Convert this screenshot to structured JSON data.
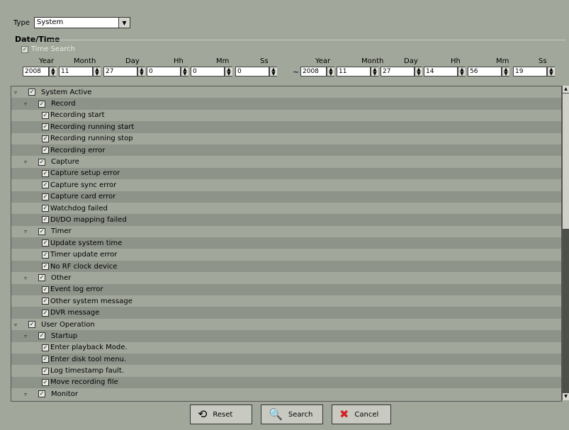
{
  "type_filter": {
    "label": "Type",
    "selected": "System"
  },
  "datetime": {
    "title": "Date/Time",
    "time_search_label": "Time Search",
    "labels": [
      "Year",
      "Month",
      "Day",
      "Hh",
      "Mm",
      "Ss"
    ],
    "from": [
      "2008",
      "11",
      "27",
      "0",
      "0",
      "0"
    ],
    "to": [
      "2008",
      "11",
      "27",
      "14",
      "56",
      "19"
    ],
    "separator": "~"
  },
  "tree": [
    {
      "level": 0,
      "expander": true,
      "label": "System Active"
    },
    {
      "level": 1,
      "expander": true,
      "label": "Record"
    },
    {
      "level": 2,
      "label": "Recording start"
    },
    {
      "level": 2,
      "label": "Recording running start"
    },
    {
      "level": 2,
      "label": "Recording running stop"
    },
    {
      "level": 2,
      "label": "Recording error"
    },
    {
      "level": 1,
      "expander": true,
      "label": "Capture"
    },
    {
      "level": 2,
      "label": "Capture setup error"
    },
    {
      "level": 2,
      "label": "Capture sync error"
    },
    {
      "level": 2,
      "label": "Capture card error"
    },
    {
      "level": 2,
      "label": "Watchdog failed"
    },
    {
      "level": 2,
      "label": "DI/DO mapping failed"
    },
    {
      "level": 1,
      "expander": true,
      "label": "Timer"
    },
    {
      "level": 2,
      "label": "Update system time"
    },
    {
      "level": 2,
      "label": "Timer update error"
    },
    {
      "level": 2,
      "label": "No RF clock device"
    },
    {
      "level": 1,
      "expander": true,
      "label": "Other"
    },
    {
      "level": 2,
      "label": "Event log error"
    },
    {
      "level": 2,
      "label": "Other system message"
    },
    {
      "level": 2,
      "label": "DVR message"
    },
    {
      "level": 0,
      "expander": true,
      "label": "User Operation"
    },
    {
      "level": 1,
      "expander": true,
      "label": "Startup"
    },
    {
      "level": 2,
      "label": "Enter playback Mode."
    },
    {
      "level": 2,
      "label": "Enter disk tool menu."
    },
    {
      "level": 2,
      "label": "Log timestamp fault."
    },
    {
      "level": 2,
      "label": "Move recording file"
    },
    {
      "level": 1,
      "expander": true,
      "label": "Monitor"
    }
  ],
  "buttons": {
    "reset": "Reset",
    "search": "Search",
    "cancel": "Cancel"
  },
  "icons": {
    "combo_arrow": "chevron-down-icon",
    "expander": "triangle-down-icon",
    "reset": "reset-icon",
    "search": "search-icon",
    "cancel": "cancel-icon"
  },
  "colors": {
    "background": "#a2a79b",
    "row_alt": "#8e9389",
    "cancel_icon": "#d42020"
  }
}
